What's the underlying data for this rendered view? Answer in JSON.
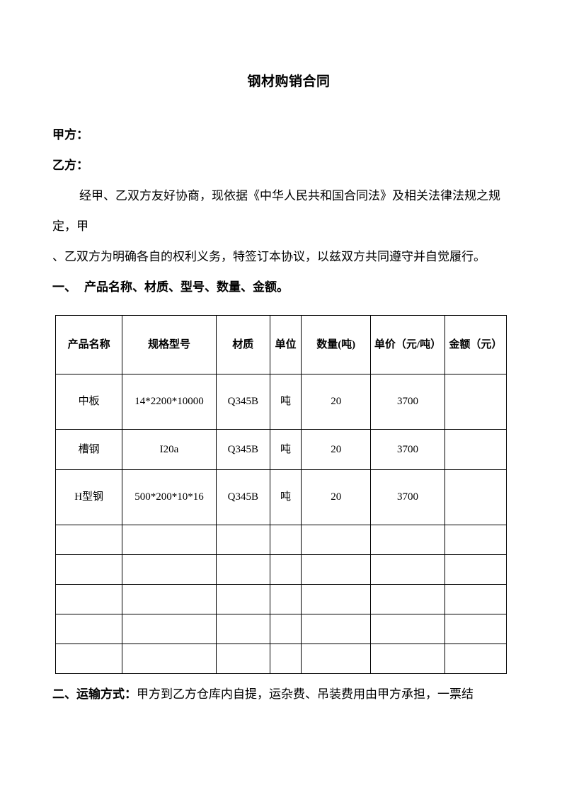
{
  "document": {
    "title": "钢材购销合同",
    "parties": [
      {
        "label": "甲方："
      },
      {
        "label": "乙方："
      }
    ],
    "preamble": {
      "line1": "经甲、乙双方友好协商，现依据《中华人民共和国合同法》及相关法律法规之规",
      "line2": "定，甲",
      "line3": "、乙双方为明确各自的权利义务，特签订本协议，以兹双方共同遵守并自觉履行。"
    },
    "section_one": {
      "number": "一、",
      "heading": "产品名称、材质、型号、数量、金额。"
    },
    "table": {
      "headers": [
        "产品名称",
        "规格型号",
        "材质",
        "单位",
        "数量(吨)",
        "单价（元/吨）",
        "金额（元）"
      ],
      "rows": [
        {
          "product": "中板",
          "spec": "14*2200*10000",
          "material": "Q345B",
          "unit": "吨",
          "quantity": "20",
          "unit_price": "3700",
          "amount": ""
        },
        {
          "product": "槽钢",
          "spec": "I20a",
          "material": "Q345B",
          "unit": "吨",
          "quantity": "20",
          "unit_price": "3700",
          "amount": ""
        },
        {
          "product": "H型钢",
          "spec": "500*200*10*16",
          "material": "Q345B",
          "unit": "吨",
          "quantity": "20",
          "unit_price": "3700",
          "amount": ""
        },
        {
          "product": "",
          "spec": "",
          "material": "",
          "unit": "",
          "quantity": "",
          "unit_price": "",
          "amount": ""
        },
        {
          "product": "",
          "spec": "",
          "material": "",
          "unit": "",
          "quantity": "",
          "unit_price": "",
          "amount": ""
        },
        {
          "product": "",
          "spec": "",
          "material": "",
          "unit": "",
          "quantity": "",
          "unit_price": "",
          "amount": ""
        },
        {
          "product": "",
          "spec": "",
          "material": "",
          "unit": "",
          "quantity": "",
          "unit_price": "",
          "amount": ""
        },
        {
          "product": "",
          "spec": "",
          "material": "",
          "unit": "",
          "quantity": "",
          "unit_price": "",
          "amount": ""
        }
      ]
    },
    "section_two": {
      "label": "二、运输方式：",
      "text": "甲方到乙方仓库内自提，运杂费、吊装费用由甲方承担，一票结"
    },
    "colors": {
      "text": "#000000",
      "border": "#000000",
      "page_background": "#ffffff"
    }
  }
}
